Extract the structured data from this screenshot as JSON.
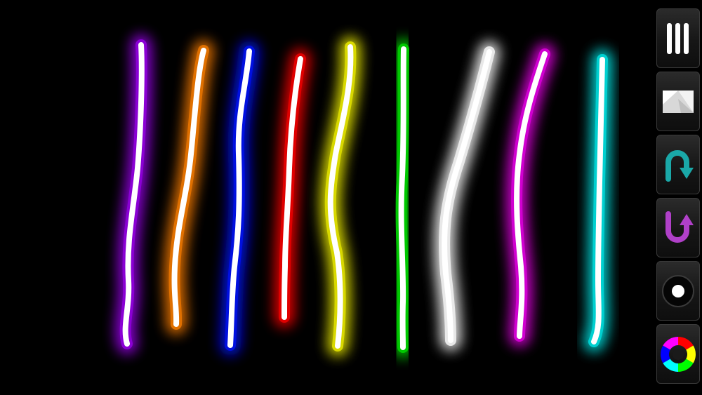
{
  "app": {
    "background": "#000000",
    "mode": "neon-draw"
  },
  "strokes": [
    {
      "name": "stroke-purple",
      "glow": "#8a00d4"
    },
    {
      "name": "stroke-orange",
      "glow": "#e07000"
    },
    {
      "name": "stroke-blue",
      "glow": "#0010e0"
    },
    {
      "name": "stroke-red",
      "glow": "#e00000"
    },
    {
      "name": "stroke-yellow",
      "glow": "#d8d800"
    },
    {
      "name": "stroke-green",
      "glow": "#00c800"
    },
    {
      "name": "stroke-white",
      "glow": "#e8e8e8"
    },
    {
      "name": "stroke-magenta",
      "glow": "#d000d0"
    },
    {
      "name": "stroke-cyan",
      "glow": "#00d0d0"
    }
  ],
  "toolbar": {
    "tools": [
      {
        "name": "brush-size-button",
        "icon": "brush-lines-icon"
      },
      {
        "name": "eraser-button",
        "icon": "eraser-icon"
      },
      {
        "name": "undo-button",
        "icon": "undo-arrow-icon",
        "color": "#1aa8a8"
      },
      {
        "name": "redo-button",
        "icon": "redo-arrow-icon",
        "color": "#b040c8"
      },
      {
        "name": "brush-dot-button",
        "icon": "brush-dot-icon"
      },
      {
        "name": "color-wheel-button",
        "icon": "color-wheel-icon"
      }
    ]
  }
}
